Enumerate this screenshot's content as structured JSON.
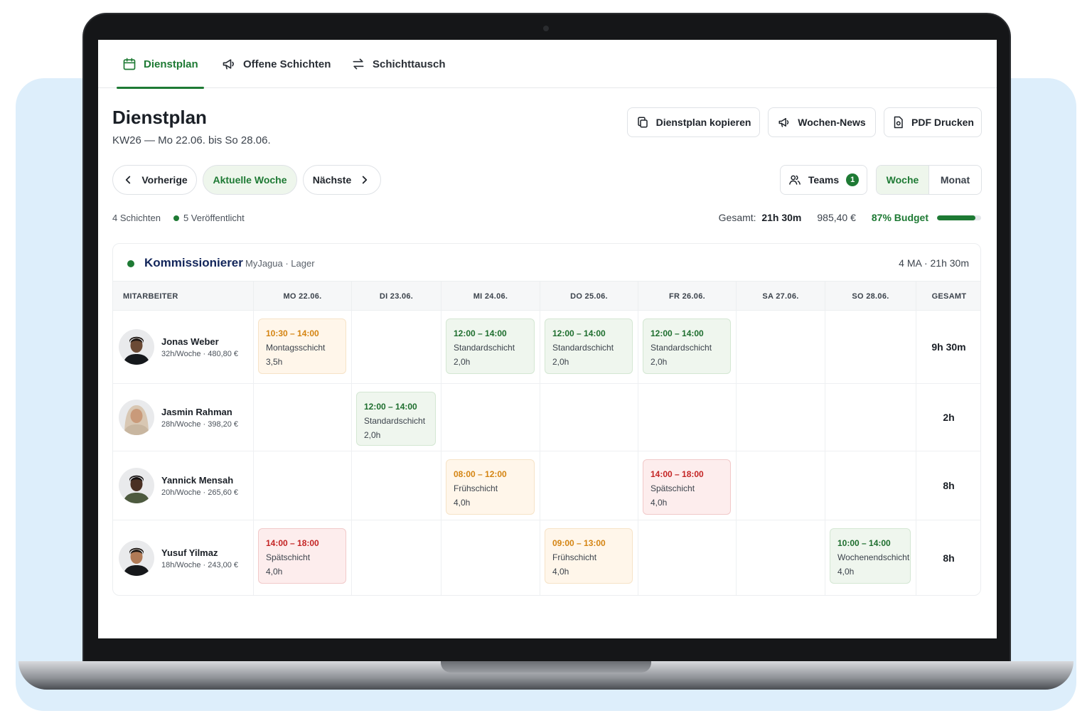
{
  "tabs": [
    {
      "label": "Dienstplan",
      "icon": "calendar-icon",
      "active": true
    },
    {
      "label": "Offene Schichten",
      "icon": "megaphone-icon",
      "active": false
    },
    {
      "label": "Schichttausch",
      "icon": "swap-icon",
      "active": false
    }
  ],
  "header": {
    "title": "Dienstplan",
    "subtitle": "KW26 — Mo 22.06. bis So 28.06."
  },
  "actions": {
    "copy": "Dienstplan kopieren",
    "news": "Wochen-News",
    "pdf": "PDF Drucken"
  },
  "nav": {
    "prev": "Vorherige",
    "current": "Aktuelle Woche",
    "next": "Nächste"
  },
  "filters": {
    "teams_label": "Teams",
    "teams_count": "1",
    "view_week": "Woche",
    "view_month": "Monat"
  },
  "stats": {
    "shifts": "4 Schichten",
    "published": "5 Veröffentlicht",
    "total_label": "Gesamt:",
    "total_value": "21h 30m",
    "cost": "985,40 €",
    "budget_label": "87% Budget",
    "budget_fraction": 0.87
  },
  "team": {
    "name": "Kommissionierer",
    "location": "MyJagua · Lager",
    "summary": "4 MA  ·  21h 30m",
    "color": "#1e7a34"
  },
  "columns": [
    "MITARBEITER",
    "MO 22.06.",
    "DI 23.06.",
    "MI 24.06.",
    "DO 25.06.",
    "FR 26.06.",
    "SA 27.06.",
    "SO 28.06.",
    "GESAMT"
  ],
  "employees": [
    {
      "name": "Jonas Weber",
      "meta": "32h/Woche · 480,80 €",
      "total": "9h 30m",
      "shifts": [
        {
          "time": "10:30 – 14:00",
          "name": "Montagsschicht",
          "hours": "3,5h"
        },
        null,
        {
          "time": "12:00 – 14:00",
          "name": "Standardschicht",
          "hours": "2,0h"
        },
        {
          "time": "12:00 – 14:00",
          "name": "Standardschicht",
          "hours": "2,0h"
        },
        {
          "time": "12:00 – 14:00",
          "name": "Standardschicht",
          "hours": "2,0h"
        },
        null,
        null
      ]
    },
    {
      "name": "Jasmin Rahman",
      "meta": "28h/Woche · 398,20 €",
      "total": "2h",
      "shifts": [
        null,
        {
          "time": "12:00 – 14:00",
          "name": "Standardschicht",
          "hours": "2,0h"
        },
        null,
        null,
        null,
        null,
        null
      ]
    },
    {
      "name": "Yannick Mensah",
      "meta": "20h/Woche · 265,60 €",
      "total": "8h",
      "shifts": [
        null,
        null,
        {
          "time": "08:00 – 12:00",
          "name": "Frühschicht",
          "hours": "4,0h"
        },
        null,
        {
          "time": "14:00 – 18:00",
          "name": "Spätschicht",
          "hours": "4,0h"
        },
        null,
        null
      ]
    },
    {
      "name": "Yusuf Yilmaz",
      "meta": "18h/Woche · 243,00 €",
      "total": "8h",
      "shifts": [
        {
          "time": "14:00 – 18:00",
          "name": "Spätschicht",
          "hours": "4,0h"
        },
        null,
        null,
        {
          "time": "09:00 – 13:00",
          "name": "Frühschicht",
          "hours": "4,0h"
        },
        null,
        null,
        {
          "time": "10:00 – 14:00",
          "name": "Wochenendschicht",
          "hours": "4,0h"
        }
      ]
    }
  ],
  "colors": {
    "accent": "#1e7a34",
    "shift_green": "#1e6e2e",
    "shift_orange": "#d48412",
    "shift_red": "#c42424"
  }
}
